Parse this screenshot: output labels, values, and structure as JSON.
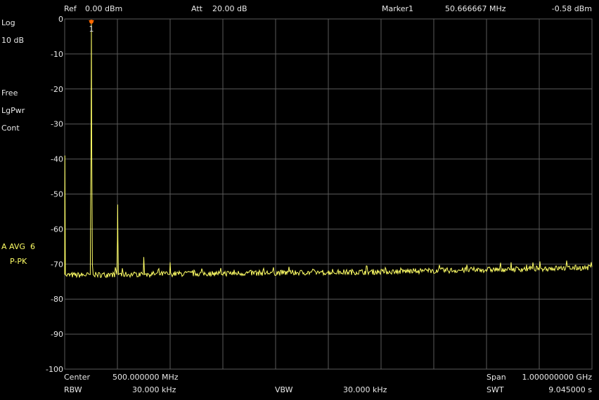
{
  "header": {
    "ref_label": "Ref",
    "ref_value": "0.00 dBm",
    "att_label": "Att",
    "att_value": "20.00 dB",
    "marker_label": "Marker1",
    "marker_freq": "50.666667 MHz",
    "marker_level": "-0.58 dBm"
  },
  "left_panel": {
    "scale_type": "Log",
    "scale_div": "10 dB",
    "trigger": "Free",
    "detector": "LgPwr",
    "sweep_mode": "Cont",
    "avg_label": "A AVG",
    "avg_count": "6",
    "avg_detector": "P-PK"
  },
  "footer": {
    "center_label": "Center",
    "center_value": "500.000000 MHz",
    "span_label": "Span",
    "span_value": "1.000000000 GHz",
    "rbw_label": "RBW",
    "rbw_value": "30.000 kHz",
    "vbw_label": "VBW",
    "vbw_value": "30.000 kHz",
    "swt_label": "SWT",
    "swt_value": "9.045000 s"
  },
  "colors": {
    "background": "#000000",
    "grid": "#5a5a5a",
    "trace": "#ffff66",
    "marker": "#ff6a00",
    "text": "#e8e8e8",
    "label_yellow": "#ffff66"
  },
  "chart_data": {
    "type": "line",
    "title": "",
    "xlabel": "",
    "ylabel": "",
    "xunit": "MHz",
    "yunit": "dBm",
    "xlim": [
      0,
      1000
    ],
    "ylim": [
      -100,
      0
    ],
    "ytick_labels": [
      "0",
      "-10",
      "-20",
      "-30",
      "-40",
      "-50",
      "-60",
      "-70",
      "-80",
      "-90",
      "-100"
    ],
    "grid": true,
    "noise_floor": {
      "x": [
        0,
        200,
        400,
        600,
        800,
        1000
      ],
      "y": [
        -73.2,
        -72.8,
        -72.5,
        -72.2,
        -71.6,
        -71.0
      ]
    },
    "series": [
      {
        "values": [
          {
            "x": 0.0,
            "y": -73.0
          },
          {
            "x": 0.4,
            "y": -39.0
          },
          {
            "x": 1.3,
            "y": -73.0
          },
          {
            "x": 48.5,
            "y": -73.0
          },
          {
            "x": 50.0,
            "y": -34.0
          },
          {
            "x": 50.667,
            "y": -0.58
          },
          {
            "x": 51.2,
            "y": -34.0
          },
          {
            "x": 52.5,
            "y": -70.0
          },
          {
            "x": 54.0,
            "y": -73.0
          },
          {
            "x": 99.0,
            "y": -73.0
          },
          {
            "x": 100.0,
            "y": -63.0
          },
          {
            "x": 100.5,
            "y": -53.0
          },
          {
            "x": 101.0,
            "y": -63.0
          },
          {
            "x": 102.0,
            "y": -73.0
          },
          {
            "x": 149.0,
            "y": -73.0
          },
          {
            "x": 150.0,
            "y": -68.0
          },
          {
            "x": 151.5,
            "y": -73.0
          },
          {
            "x": 199.0,
            "y": -73.0
          },
          {
            "x": 200.0,
            "y": -69.5
          },
          {
            "x": 201.0,
            "y": -72.5
          }
        ]
      }
    ],
    "marker": {
      "name": "1",
      "x": 50.666667,
      "y": -0.58
    }
  }
}
